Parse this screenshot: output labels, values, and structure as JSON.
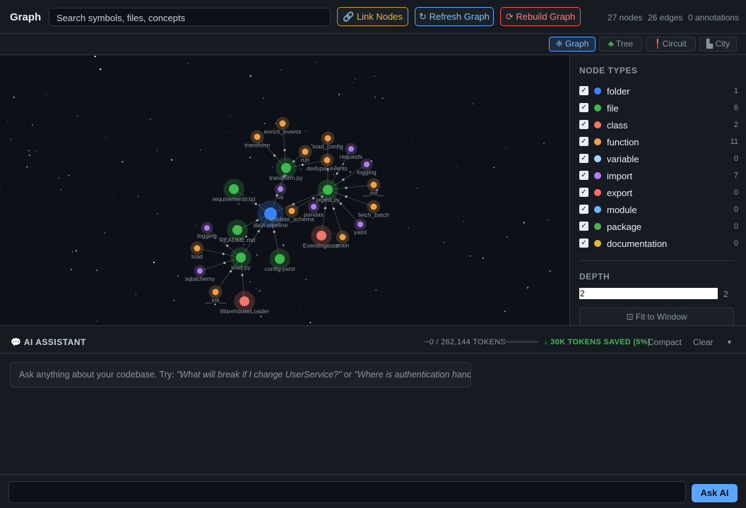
{
  "app": {
    "title": "Graph"
  },
  "search": {
    "value": "Search symbols, files, concepts"
  },
  "toolbar": {
    "link_nodes": "Link Nodes",
    "refresh_graph": "Refresh Graph",
    "rebuild_graph": "Rebuild Graph",
    "link_icon": "link-icon",
    "refresh_icon": "refresh-icon",
    "rebuild_icon": "rebuild-icon"
  },
  "stats": {
    "nodes": "27 nodes",
    "edges": "26 edges",
    "annotations": "0 annotations"
  },
  "views": [
    {
      "label": "Graph",
      "icon": "graph-icon",
      "active": true
    },
    {
      "label": "Tree",
      "icon": "tree-icon",
      "active": false
    },
    {
      "label": "Circuit",
      "icon": "circuit-icon",
      "active": false
    },
    {
      "label": "City",
      "icon": "city-icon",
      "active": false
    }
  ],
  "graph": {
    "nodes": [
      {
        "label": "data-pipeline",
        "type": "folder"
      },
      {
        "label": "transform.py",
        "type": "file"
      },
      {
        "label": "ingest.py",
        "type": "file"
      },
      {
        "label": "requirements.txt",
        "type": "file"
      },
      {
        "label": "README.md",
        "type": "file"
      },
      {
        "label": "load.py",
        "type": "file"
      },
      {
        "label": "config.yaml",
        "type": "file"
      },
      {
        "label": "EventIngestor",
        "type": "class"
      },
      {
        "label": "WarehouseLoader",
        "type": "class"
      },
      {
        "label": "enrich_events",
        "type": "function"
      },
      {
        "label": "transform",
        "type": "function"
      },
      {
        "label": "load_config",
        "type": "function"
      },
      {
        "label": "run",
        "type": "function"
      },
      {
        "label": "dedupe_events",
        "type": "function"
      },
      {
        "label": "__init__",
        "type": "function"
      },
      {
        "label": "fetch_batch",
        "type": "function"
      },
      {
        "label": "validate_schema",
        "type": "function"
      },
      {
        "label": "main",
        "type": "function"
      },
      {
        "label": "load",
        "type": "function"
      },
      {
        "label": "__init__",
        "type": "function"
      },
      {
        "label": "requests",
        "type": "import"
      },
      {
        "label": "logging",
        "type": "import"
      },
      {
        "label": "os",
        "type": "import"
      },
      {
        "label": "pandas",
        "type": "import"
      },
      {
        "label": "yaml",
        "type": "import"
      },
      {
        "label": "logging",
        "type": "import"
      },
      {
        "label": "sqlalchemy",
        "type": "import"
      }
    ]
  },
  "panel": {
    "node_types_title": "NODE TYPES",
    "node_types": [
      {
        "label": "folder",
        "count": "1",
        "color": "#3b82f6"
      },
      {
        "label": "file",
        "count": "6",
        "color": "#3fb950"
      },
      {
        "label": "class",
        "count": "2",
        "color": "#f0776c"
      },
      {
        "label": "function",
        "count": "11",
        "color": "#f0a04b"
      },
      {
        "label": "variable",
        "count": "0",
        "color": "#a5d6ff"
      },
      {
        "label": "import",
        "count": "7",
        "color": "#b180f0"
      },
      {
        "label": "export",
        "count": "0",
        "color": "#f47067"
      },
      {
        "label": "module",
        "count": "0",
        "color": "#6cb6ff"
      },
      {
        "label": "package",
        "count": "0",
        "color": "#57ab5a"
      },
      {
        "label": "documentation",
        "count": "0",
        "color": "#e3b341"
      }
    ],
    "depth_title": "DEPTH",
    "depth_value": "2",
    "depth_display": "2",
    "fit_button": "Fit to Window",
    "fit_icon": "fit-window-icon"
  },
  "assistant": {
    "title": "AI ASSISTANT",
    "icon": "chat-bubble-icon",
    "tokens": "~0 / 262,144 TOKENS",
    "saved": "↓ 30K TOKENS SAVED (5%)",
    "compact": "Compact",
    "clear": "Clear",
    "hint_prefix": "Ask anything about your codebase. Try: ",
    "hint_example1": "\"What will break if I change UserService?\"",
    "hint_middle": " or ",
    "hint_example2": "\"Where is authentication handled?\"",
    "ask_button": "Ask AI",
    "ask_value": ""
  }
}
